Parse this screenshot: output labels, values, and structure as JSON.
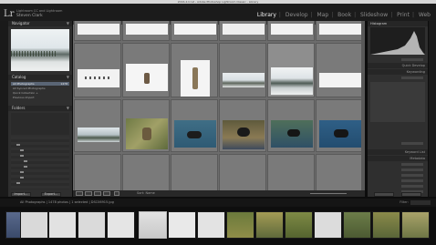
{
  "window": {
    "title": "2016-2.lrcat - Adobe Photoshop Lightroom Classic - Library"
  },
  "identity": {
    "logo": "Lr",
    "line1": "Lightroom CC and Lightroom",
    "line2": "Steven Clark"
  },
  "modules": [
    "Library",
    "Develop",
    "Map",
    "Book",
    "Slideshow",
    "Print",
    "Web"
  ],
  "active_module": "Library",
  "left_panel": {
    "navigator": "Navigator",
    "catalog": "Catalog",
    "catalog_items": [
      {
        "label": "All Photographs",
        "count": "1478"
      },
      {
        "label": "All Synced Photographs",
        "count": ""
      },
      {
        "label": "Quick Collection +",
        "count": ""
      },
      {
        "label": "Previous Import",
        "count": ""
      }
    ],
    "folders": "Folders",
    "import_label": "Import...",
    "export_label": "Export..."
  },
  "toolbar": {
    "sort_label": "Sort: Name"
  },
  "right_panel": {
    "histogram": "Histogram",
    "quick_develop": "Quick Develop",
    "keywording": "Keywording",
    "keyword_list": "Keyword List",
    "metadata": "Metadata",
    "comments": "Comments",
    "preset_value": "Default",
    "sync_label": "Sync Metadata",
    "sync_settings_label": "Sync Settings"
  },
  "filmstrip": {
    "source": "All Photographs  |  1478 photos  |  1 selected  |  DSC06915.jpg",
    "filter_label": "Filter:",
    "filter_value": "Filters Off"
  },
  "colors": {
    "accent": "#5a6575",
    "grid_bg": "#6c6c6c",
    "panel_bg": "#2f2f2f"
  }
}
